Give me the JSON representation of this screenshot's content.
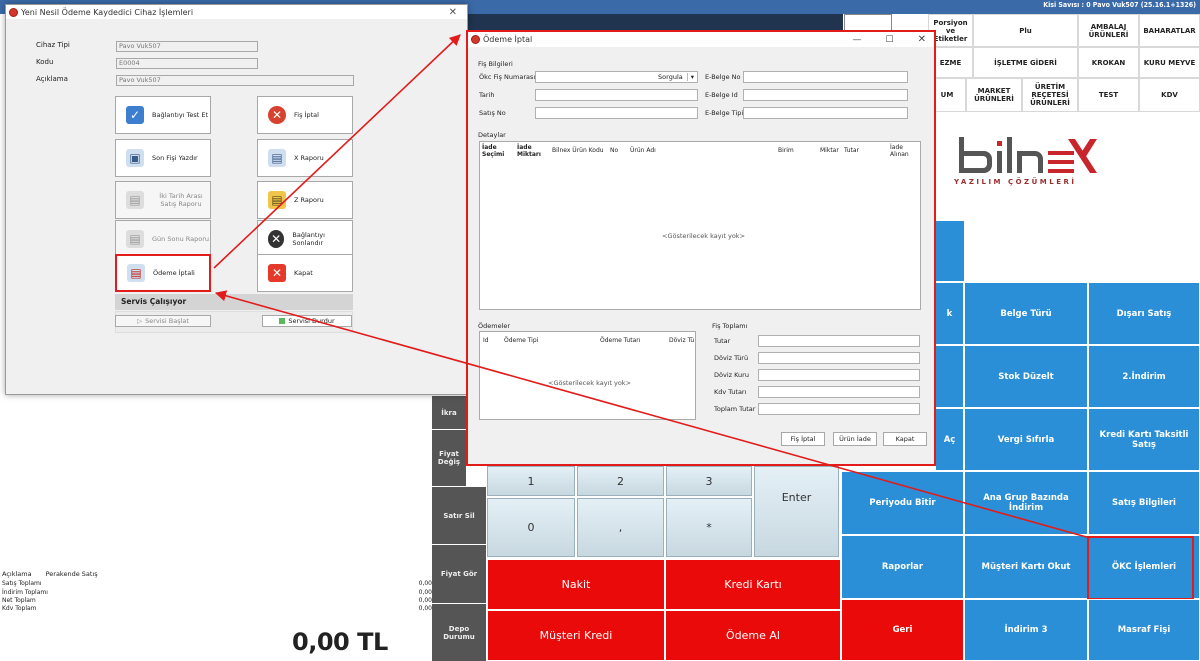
{
  "pos": {
    "session_info": "Kisi Savısı : 0 Pavo Vuk507 (25.16.1+1326)",
    "categories": [
      [
        "Porsiyon ve Etiketler",
        "Plu",
        "AMBALAJ ÜRÜNLERİ",
        "BAHARATLAR"
      ],
      [
        "EZME",
        "İŞLETME GİDERİ",
        "KROKAN",
        "KURU MEYVE"
      ],
      [
        "UM",
        "MARKET ÜRÜNLERİ",
        "ÜRETİM REÇETESİ ÜRÜNLERİ",
        "TEST",
        "KDV"
      ]
    ],
    "logo_text": "YAZILIM ÇÖZÜMLERİ",
    "blue_row1": [
      "k",
      "Belge Türü",
      "Dışarı Satış"
    ],
    "blue_row2": [
      "Stok Düzelt",
      "2.İndirim"
    ],
    "blue_row3": [
      "Aç",
      "Vergi Sıfırla",
      "Kredi Kartı Taksitli Satış"
    ],
    "blue_row4": [
      "Periyodu Bitir",
      "Ana Grup Bazında İndirim",
      "Satış Bilgileri"
    ],
    "blue_row5": [
      "Raporlar",
      "Müşteri Kartı Okut",
      "ÖKC İşlemleri"
    ],
    "blue_row6": [
      "Geri",
      "İndirim 3",
      "Masraf Fişi"
    ],
    "side_buttons": [
      "İkra",
      "Fiyat Değiş",
      "Satır Sil",
      "Fiyat Gör",
      "Depo Durumu"
    ],
    "keypad": {
      "k1": "1",
      "k2": "2",
      "k3": "3",
      "k0": "0",
      "comma": ",",
      "star": "*",
      "enter": "Enter"
    },
    "red_buttons": {
      "nakit": "Nakit",
      "kredi_karti": "Kredi Kartı",
      "musteri_kredi": "Müşteri Kredi",
      "odeme_al": "Ödeme Al"
    },
    "summary": {
      "aciklama_label": "Açıklama",
      "aciklama_value": "Perakende Satış",
      "rows": [
        {
          "label": "Satış Toplamı",
          "value": "0,00"
        },
        {
          "label": "İndirim Toplamı",
          "value": "0,00"
        },
        {
          "label": "Net Toplam",
          "value": "0,00"
        },
        {
          "label": "Kdv Toplam",
          "value": "0,00"
        }
      ],
      "total": "0,00 TL"
    }
  },
  "dialog1": {
    "title": "Yeni Nesil Ödeme Kaydedici Cihaz İşlemleri",
    "fields": {
      "cihaz_tipi_label": "Cihaz Tipi",
      "cihaz_tipi_value": "Pavo Vuk507",
      "kodu_label": "Kodu",
      "kodu_value": "E0004",
      "aciklama_label": "Açıklama",
      "aciklama_value": "Pavo Vuk507"
    },
    "buttons": {
      "test": "Bağlantıyı Test Et",
      "fis_iptal": "Fiş İptal",
      "son_fisi": "Son Fişi Yazdır",
      "x_raporu": "X Raporu",
      "iki_tarih": "İki Tarih Arası Satış Raporu",
      "z_raporu": "Z Raporu",
      "gun_sonu": "Gün Sonu Raporu",
      "baglanti_sonlandir": "Bağlantıyı Sonlandır",
      "odeme_iptali": "Ödeme İptali",
      "kapat": "Kapat"
    },
    "service": {
      "status": "Servis Çalışıyor",
      "start": "Servisi Başlat",
      "stop": "Servisi Durdur"
    }
  },
  "dialog2": {
    "title": "Ödeme İptal",
    "fis_bilgileri": "Fiş Bilgileri",
    "okc_fis_label": "Ökc Fiş Numarası",
    "sorgula": "Sorgula",
    "tarih_label": "Tarih",
    "satis_no_label": "Satış No",
    "ebelge_no_label": "E-Belge No",
    "ebelge_id_label": "E-Belge Id",
    "ebelge_tipi_label": "E-Belge Tipi",
    "detaylar": "Detaylar",
    "detay_cols": [
      "İade Seçimi",
      "İade Miktarı",
      "Bilnex Ürün Kodu",
      "No",
      "Ürün Adı",
      "Birim",
      "Miktar",
      "Tutar",
      "İade Alınan"
    ],
    "empty": "<Gösterilecek kayıt yok>",
    "odemeler": "Ödemeler",
    "odeme_cols": [
      "Id",
      "Ödeme Tipi",
      "Ödeme Tutarı",
      "Döviz Tü"
    ],
    "fis_toplami": "Fiş Toplamı",
    "toplam_fields": [
      "Tutar",
      "Döviz Türü",
      "Döviz Kuru",
      "Kdv Tutarı",
      "Toplam Tutar"
    ],
    "btn_fis_iptal": "Fiş İptal",
    "btn_urun_iade": "Ürün İade",
    "btn_kapat": "Kapat"
  },
  "colors": {
    "blue": "#2a8fd6",
    "red": "#ea0a0a",
    "highlight": "#e21b1b"
  }
}
